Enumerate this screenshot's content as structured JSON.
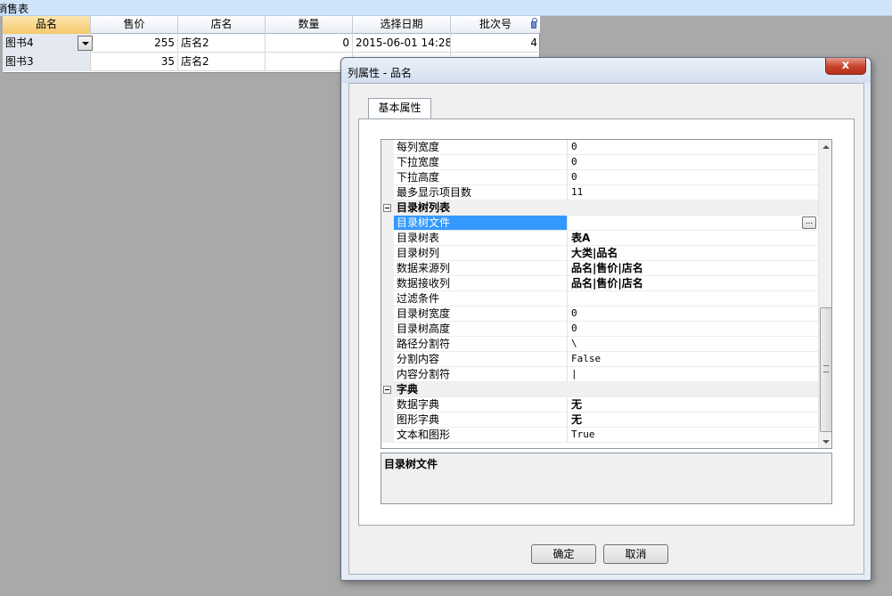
{
  "app": {
    "title": "销售表"
  },
  "grid": {
    "columns": [
      "品名",
      "售价",
      "店名",
      "数量",
      "选择日期",
      "批次号"
    ],
    "rows": [
      {
        "name": "图书4",
        "price": "255",
        "store": "店名2",
        "qty": "0",
        "date": "2015-06-01 14:28",
        "batch": "4"
      },
      {
        "name": "图书3",
        "price": "35",
        "store": "店名2",
        "qty": "",
        "date": "",
        "batch": ""
      }
    ]
  },
  "dialog": {
    "title": "列属性 - 品名",
    "close_label": "x",
    "tab_label": "基本属性",
    "properties": [
      {
        "name": "每列宽度",
        "value": "0",
        "type": "item"
      },
      {
        "name": "下拉宽度",
        "value": "0",
        "type": "item"
      },
      {
        "name": "下拉高度",
        "value": "0",
        "type": "item"
      },
      {
        "name": "最多显示项目数",
        "value": "11",
        "type": "item"
      },
      {
        "name": "目录树列表",
        "value": "",
        "type": "category"
      },
      {
        "name": "目录树文件",
        "value": "",
        "type": "selected"
      },
      {
        "name": "目录树表",
        "value": "表A",
        "type": "bold"
      },
      {
        "name": "目录树列",
        "value": "大类|品名",
        "type": "bold"
      },
      {
        "name": "数据来源列",
        "value": "品名|售价|店名",
        "type": "bold"
      },
      {
        "name": "数据接收列",
        "value": "品名|售价|店名",
        "type": "bold"
      },
      {
        "name": "过滤条件",
        "value": "",
        "type": "item"
      },
      {
        "name": "目录树宽度",
        "value": "0",
        "type": "item"
      },
      {
        "name": "目录树高度",
        "value": "0",
        "type": "item"
      },
      {
        "name": "路径分割符",
        "value": "\\",
        "type": "item"
      },
      {
        "name": "分割内容",
        "value": "False",
        "type": "item"
      },
      {
        "name": "内容分割符",
        "value": "|",
        "type": "item"
      },
      {
        "name": "字典",
        "value": "",
        "type": "category"
      },
      {
        "name": "数据字典",
        "value": "无",
        "type": "bold"
      },
      {
        "name": "图形字典",
        "value": "无",
        "type": "bold"
      },
      {
        "name": "文本和图形",
        "value": "True",
        "type": "item"
      }
    ],
    "ellipsis_label": "...",
    "description_title": "目录树文件",
    "ok_label": "确定",
    "cancel_label": "取消"
  }
}
